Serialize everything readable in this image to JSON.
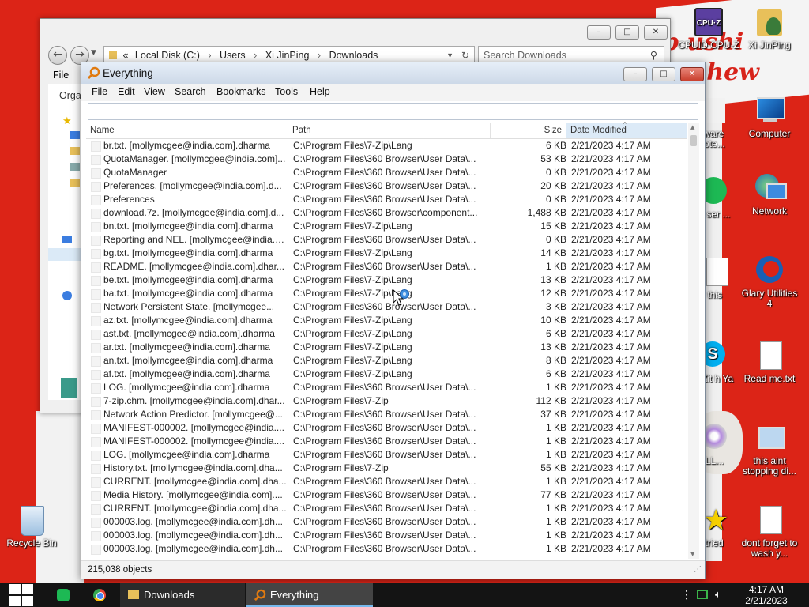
{
  "explorer": {
    "address_prefix": "«",
    "breadcrumbs": [
      "Local Disk (C:)",
      "Users",
      "Xi JinPing",
      "Downloads"
    ],
    "search_placeholder": "Search Downloads",
    "menu_file": "File",
    "left_organize": "Orga",
    "buttons": {
      "min": "–",
      "max": "□",
      "close": "✕"
    }
  },
  "everything": {
    "title": "Everything",
    "menu": [
      "File",
      "Edit",
      "View",
      "Search",
      "Bookmarks",
      "Tools",
      "Help"
    ],
    "columns": {
      "name": "Name",
      "path": "Path",
      "size": "Size",
      "date": "Date Modified"
    },
    "rows": [
      {
        "name": "br.txt. [mollymcgee@india.com].dharma",
        "path": "C:\\Program Files\\7-Zip\\Lang",
        "size": "6 KB",
        "date": "2/21/2023 4:17 AM"
      },
      {
        "name": "QuotaManager. [mollymcgee@india.com]...",
        "path": "C:\\Program Files\\360 Browser\\User Data\\...",
        "size": "53 KB",
        "date": "2/21/2023 4:17 AM"
      },
      {
        "name": "QuotaManager",
        "path": "C:\\Program Files\\360 Browser\\User Data\\...",
        "size": "0 KB",
        "date": "2/21/2023 4:17 AM"
      },
      {
        "name": "Preferences. [mollymcgee@india.com].d...",
        "path": "C:\\Program Files\\360 Browser\\User Data\\...",
        "size": "20 KB",
        "date": "2/21/2023 4:17 AM"
      },
      {
        "name": "Preferences",
        "path": "C:\\Program Files\\360 Browser\\User Data\\...",
        "size": "0 KB",
        "date": "2/21/2023 4:17 AM"
      },
      {
        "name": "download.7z. [mollymcgee@india.com].d...",
        "path": "C:\\Program Files\\360 Browser\\component...",
        "size": "1,488 KB",
        "date": "2/21/2023 4:17 AM"
      },
      {
        "name": "bn.txt. [mollymcgee@india.com].dharma",
        "path": "C:\\Program Files\\7-Zip\\Lang",
        "size": "15 KB",
        "date": "2/21/2023 4:17 AM"
      },
      {
        "name": "Reporting and NEL. [mollymcgee@india.c...",
        "path": "C:\\Program Files\\360 Browser\\User Data\\...",
        "size": "0 KB",
        "date": "2/21/2023 4:17 AM"
      },
      {
        "name": "bg.txt. [mollymcgee@india.com].dharma",
        "path": "C:\\Program Files\\7-Zip\\Lang",
        "size": "14 KB",
        "date": "2/21/2023 4:17 AM"
      },
      {
        "name": "README. [mollymcgee@india.com].dhar...",
        "path": "C:\\Program Files\\360 Browser\\User Data\\...",
        "size": "1 KB",
        "date": "2/21/2023 4:17 AM"
      },
      {
        "name": "be.txt. [mollymcgee@india.com].dharma",
        "path": "C:\\Program Files\\7-Zip\\Lang",
        "size": "13 KB",
        "date": "2/21/2023 4:17 AM"
      },
      {
        "name": "ba.txt. [mollymcgee@india.com].dharma",
        "path": "C:\\Program Files\\7-Zip\\Lang",
        "size": "12 KB",
        "date": "2/21/2023 4:17 AM"
      },
      {
        "name": "Network Persistent State. [mollymcgee...",
        "path": "C:\\Program Files\\360 Browser\\User Data\\...",
        "size": "3 KB",
        "date": "2/21/2023 4:17 AM"
      },
      {
        "name": "az.txt. [mollymcgee@india.com].dharma",
        "path": "C:\\Program Files\\7-Zip\\Lang",
        "size": "10 KB",
        "date": "2/21/2023 4:17 AM"
      },
      {
        "name": "ast.txt. [mollymcgee@india.com].dharma",
        "path": "C:\\Program Files\\7-Zip\\Lang",
        "size": "6 KB",
        "date": "2/21/2023 4:17 AM"
      },
      {
        "name": "ar.txt. [mollymcgee@india.com].dharma",
        "path": "C:\\Program Files\\7-Zip\\Lang",
        "size": "13 KB",
        "date": "2/21/2023 4:17 AM"
      },
      {
        "name": "an.txt. [mollymcgee@india.com].dharma",
        "path": "C:\\Program Files\\7-Zip\\Lang",
        "size": "8 KB",
        "date": "2/21/2023 4:17 AM"
      },
      {
        "name": "af.txt. [mollymcgee@india.com].dharma",
        "path": "C:\\Program Files\\7-Zip\\Lang",
        "size": "6 KB",
        "date": "2/21/2023 4:17 AM"
      },
      {
        "name": "LOG. [mollymcgee@india.com].dharma",
        "path": "C:\\Program Files\\360 Browser\\User Data\\...",
        "size": "1 KB",
        "date": "2/21/2023 4:17 AM"
      },
      {
        "name": "7-zip.chm. [mollymcgee@india.com].dhar...",
        "path": "C:\\Program Files\\7-Zip",
        "size": "112 KB",
        "date": "2/21/2023 4:17 AM"
      },
      {
        "name": "Network Action Predictor. [mollymcgee@...",
        "path": "C:\\Program Files\\360 Browser\\User Data\\...",
        "size": "37 KB",
        "date": "2/21/2023 4:17 AM"
      },
      {
        "name": "MANIFEST-000002. [mollymcgee@india....",
        "path": "C:\\Program Files\\360 Browser\\User Data\\...",
        "size": "1 KB",
        "date": "2/21/2023 4:17 AM"
      },
      {
        "name": "MANIFEST-000002. [mollymcgee@india....",
        "path": "C:\\Program Files\\360 Browser\\User Data\\...",
        "size": "1 KB",
        "date": "2/21/2023 4:17 AM"
      },
      {
        "name": "LOG. [mollymcgee@india.com].dharma",
        "path": "C:\\Program Files\\360 Browser\\User Data\\...",
        "size": "1 KB",
        "date": "2/21/2023 4:17 AM"
      },
      {
        "name": "History.txt. [mollymcgee@india.com].dha...",
        "path": "C:\\Program Files\\7-Zip",
        "size": "55 KB",
        "date": "2/21/2023 4:17 AM"
      },
      {
        "name": "CURRENT. [mollymcgee@india.com].dha...",
        "path": "C:\\Program Files\\360 Browser\\User Data\\...",
        "size": "1 KB",
        "date": "2/21/2023 4:17 AM"
      },
      {
        "name": "Media History. [mollymcgee@india.com]....",
        "path": "C:\\Program Files\\360 Browser\\User Data\\...",
        "size": "77 KB",
        "date": "2/21/2023 4:17 AM"
      },
      {
        "name": "CURRENT. [mollymcgee@india.com].dha...",
        "path": "C:\\Program Files\\360 Browser\\User Data\\...",
        "size": "1 KB",
        "date": "2/21/2023 4:17 AM"
      },
      {
        "name": "000003.log. [mollymcgee@india.com].dh...",
        "path": "C:\\Program Files\\360 Browser\\User Data\\...",
        "size": "1 KB",
        "date": "2/21/2023 4:17 AM"
      },
      {
        "name": "000003.log. [mollymcgee@india.com].dh...",
        "path": "C:\\Program Files\\360 Browser\\User Data\\...",
        "size": "1 KB",
        "date": "2/21/2023 4:17 AM"
      },
      {
        "name": "000003.log. [mollymcgee@india.com].dh...",
        "path": "C:\\Program Files\\360 Browser\\User Data\\...",
        "size": "1 KB",
        "date": "2/21/2023 4:17 AM"
      }
    ],
    "status": "215,038 objects",
    "buttons": {
      "min": "–",
      "max": "□",
      "close": "✕"
    }
  },
  "desktop": {
    "wallpaper_text_1": "p  ushi",
    "wallpaper_text_2": "chew",
    "icons": [
      {
        "label": "CPUID CPU-Z",
        "icon": "cpuz-icon"
      },
      {
        "label": "Xi JinPing",
        "icon": "user-folder-icon"
      },
      {
        "label": "eware Note...",
        "icon": "app-icon"
      },
      {
        "label": "Computer",
        "icon": "computer-icon"
      },
      {
        "label": "sed ser ...",
        "icon": "spotify-icon"
      },
      {
        "label": "Network",
        "icon": "network-icon"
      },
      {
        "label": "s this",
        "icon": "document-icon"
      },
      {
        "label": "Glary Utilities 4",
        "icon": "glary-icon"
      },
      {
        "label": "hat Zit h Ya",
        "icon": "skype-icon"
      },
      {
        "label": "Read me.txt",
        "icon": "text-file-icon"
      },
      {
        "label": "ULL...",
        "icon": "disc-icon"
      },
      {
        "label": "this aint stopping di...",
        "icon": "shortcut-icon"
      },
      {
        "label": "tried",
        "icon": "star-icon"
      },
      {
        "label": "dont forget to wash y...",
        "icon": "document-icon"
      },
      {
        "label": "Recycle Bin",
        "icon": "recycle-bin-icon"
      }
    ]
  },
  "taskbar": {
    "tasks": [
      {
        "label": "Downloads",
        "icon": "folder-icon"
      },
      {
        "label": "Everything",
        "icon": "everything-icon"
      }
    ],
    "time": "4:17 AM",
    "date": "2/21/2023"
  },
  "colors": {
    "accent": "#0078d7",
    "wallpaper": "#dc2417",
    "taskbar": "#141414"
  }
}
